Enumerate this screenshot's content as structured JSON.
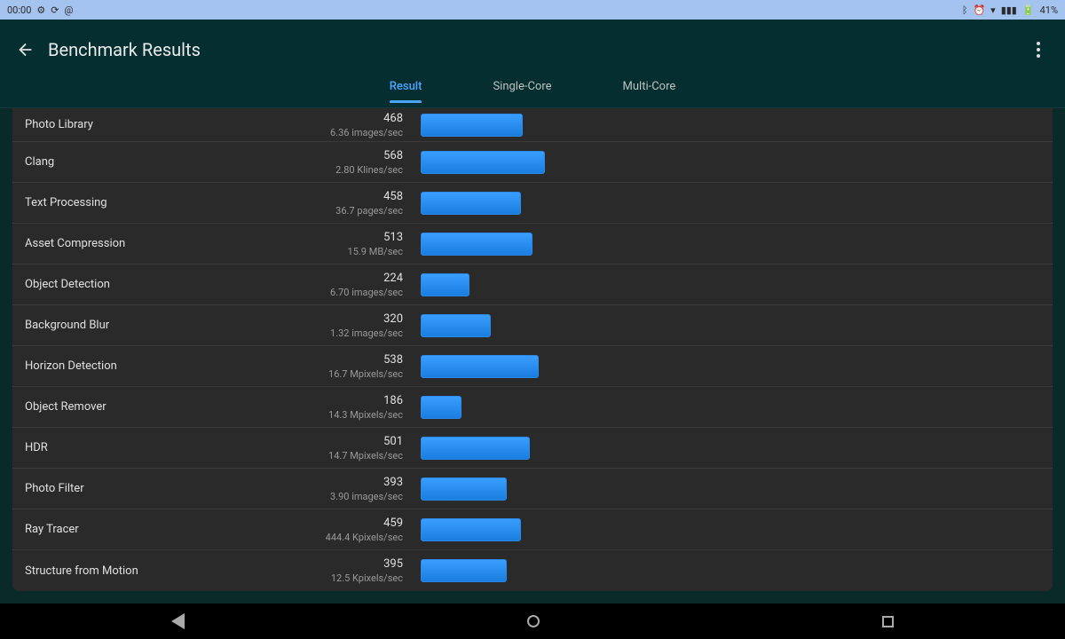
{
  "status_bar": {
    "time": "00:00",
    "battery": "41%"
  },
  "header": {
    "title": "Benchmark Results"
  },
  "tabs": [
    {
      "label": "Result",
      "active": true
    },
    {
      "label": "Single-Core",
      "active": false
    },
    {
      "label": "Multi-Core",
      "active": false
    }
  ],
  "max_score": 568,
  "results": [
    {
      "name": "Photo Library",
      "score": "468",
      "sub": "6.36 images/sec",
      "val": 468
    },
    {
      "name": "Clang",
      "score": "568",
      "sub": "2.80 Klines/sec",
      "val": 568
    },
    {
      "name": "Text Processing",
      "score": "458",
      "sub": "36.7 pages/sec",
      "val": 458
    },
    {
      "name": "Asset Compression",
      "score": "513",
      "sub": "15.9 MB/sec",
      "val": 513
    },
    {
      "name": "Object Detection",
      "score": "224",
      "sub": "6.70 images/sec",
      "val": 224
    },
    {
      "name": "Background Blur",
      "score": "320",
      "sub": "1.32 images/sec",
      "val": 320
    },
    {
      "name": "Horizon Detection",
      "score": "538",
      "sub": "16.7 Mpixels/sec",
      "val": 538
    },
    {
      "name": "Object Remover",
      "score": "186",
      "sub": "14.3 Mpixels/sec",
      "val": 186
    },
    {
      "name": "HDR",
      "score": "501",
      "sub": "14.7 Mpixels/sec",
      "val": 501
    },
    {
      "name": "Photo Filter",
      "score": "393",
      "sub": "3.90 images/sec",
      "val": 393
    },
    {
      "name": "Ray Tracer",
      "score": "459",
      "sub": "444.4 Kpixels/sec",
      "val": 459
    },
    {
      "name": "Structure from Motion",
      "score": "395",
      "sub": "12.5 Kpixels/sec",
      "val": 395
    }
  ],
  "chart_data": {
    "type": "bar",
    "orientation": "horizontal",
    "title": "Benchmark Results — Result tab",
    "categories": [
      "Photo Library",
      "Clang",
      "Text Processing",
      "Asset Compression",
      "Object Detection",
      "Background Blur",
      "Horizon Detection",
      "Object Remover",
      "HDR",
      "Photo Filter",
      "Ray Tracer",
      "Structure from Motion"
    ],
    "values": [
      468,
      568,
      458,
      513,
      224,
      320,
      538,
      186,
      501,
      393,
      459,
      395
    ],
    "units": [
      "images/sec",
      "Klines/sec",
      "pages/sec",
      "MB/sec",
      "images/sec",
      "images/sec",
      "Mpixels/sec",
      "Mpixels/sec",
      "Mpixels/sec",
      "images/sec",
      "Kpixels/sec",
      "Kpixels/sec"
    ],
    "rate_values": [
      6.36,
      2.8,
      36.7,
      15.9,
      6.7,
      1.32,
      16.7,
      14.3,
      14.7,
      3.9,
      444.4,
      12.5
    ],
    "xlabel": "",
    "ylabel": ""
  }
}
